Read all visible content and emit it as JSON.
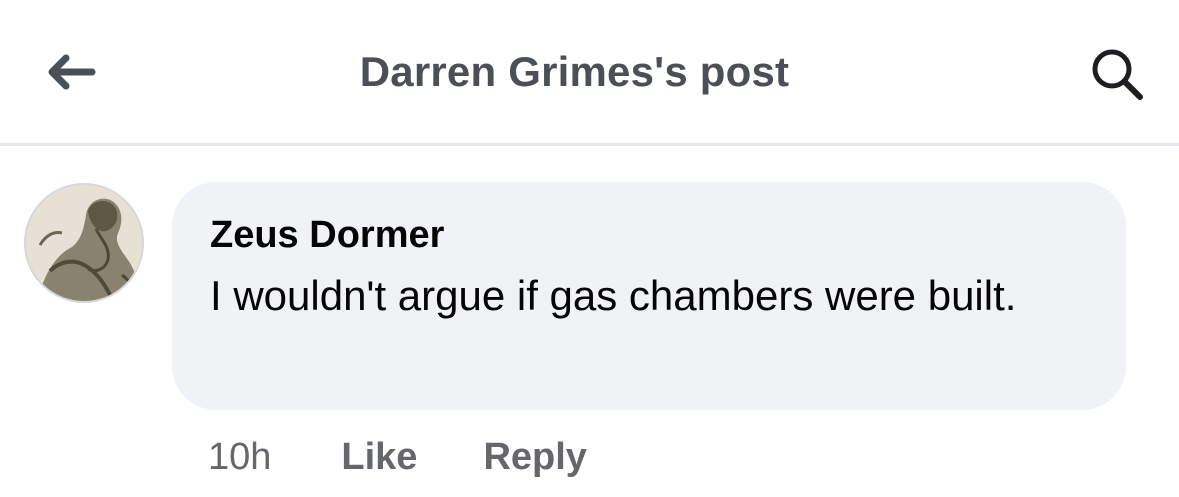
{
  "header": {
    "title": "Darren Grimes's post",
    "back_icon": "arrow-left-icon",
    "search_icon": "search-icon"
  },
  "comment": {
    "author": "Zeus Dormer",
    "text": "I wouldn't argue if gas chambers were built.",
    "avatar_icon": "avatar-image",
    "time": "10h",
    "like_label": "Like",
    "reply_label": "Reply"
  },
  "colors": {
    "header_text": "#4b4f56",
    "bubble_bg": "#f0f2f5",
    "meta_text": "#65676b",
    "divider": "#e4e6eb"
  }
}
